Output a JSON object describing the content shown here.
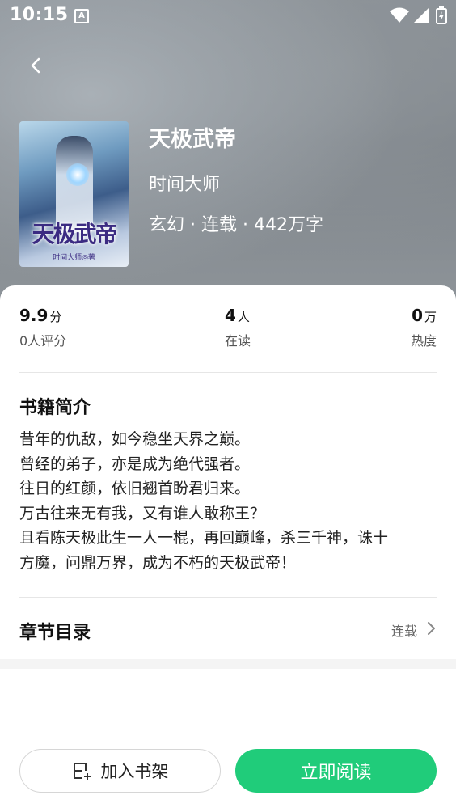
{
  "status_bar": {
    "time": "10:15",
    "app_indicator": "A",
    "icons": [
      "wifi-icon",
      "signal-icon",
      "battery-charging-icon"
    ]
  },
  "header": {
    "back_icon": "chevron-left-icon"
  },
  "book": {
    "cover_title_art": "天极武帝",
    "cover_author_art": "时间大师◎著",
    "title": "天极武帝",
    "author": "时间大师",
    "meta": "玄幻 · 连载 · 442万字"
  },
  "stats": {
    "rating": {
      "value": "9.9",
      "unit": "分",
      "label": "0人评分"
    },
    "readers": {
      "value": "4",
      "unit": "人",
      "label": "在读"
    },
    "heat": {
      "value": "0",
      "unit": "万",
      "label": "热度"
    }
  },
  "intro": {
    "heading": "书籍简介",
    "lines": [
      "昔年的仇敌，如今稳坐天界之巅。",
      "曾经的弟子，亦是成为绝代强者。",
      "往日的红颜，依旧翘首盼君归来。",
      "万古往来无有我，又有谁人敢称王？",
      "且看陈天极此生一人一棍，再回巅峰，杀三千神，诛十",
      "方魔，问鼎万界，成为不朽的天极武帝！"
    ]
  },
  "chapters": {
    "heading": "章节目录",
    "status": "连载",
    "icon": "chevron-right-icon"
  },
  "actions": {
    "add_shelf": {
      "label": "加入书架",
      "icon": "bookshelf-add-icon"
    },
    "read_now": {
      "label": "立即阅读"
    }
  },
  "colors": {
    "accent": "#20cc7a",
    "hero_bg": "#868c92"
  }
}
